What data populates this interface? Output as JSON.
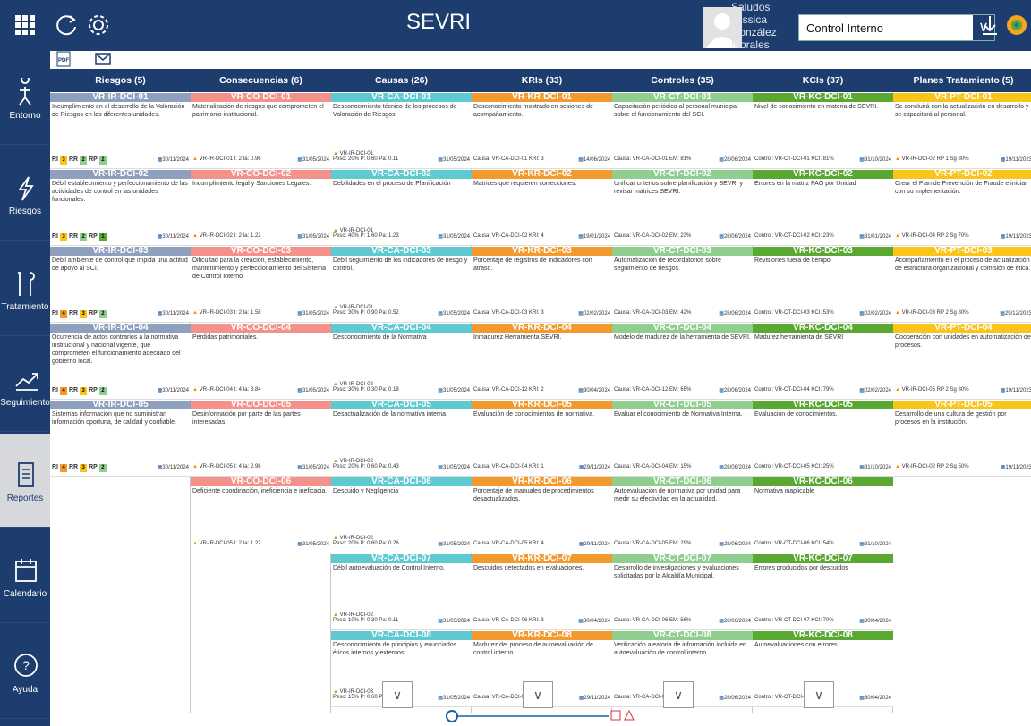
{
  "app": {
    "title": "SEVRI"
  },
  "user": {
    "name": "Saludos Jessica González Morales"
  },
  "entity_select": {
    "value": "Control Interno"
  },
  "colors": {
    "navy": "#1d3d6e",
    "riesgos": "#8fa0bf",
    "consecuencias": "#f4918a",
    "causas": "#5ec9d0",
    "kris": "#f39a2e",
    "controles": "#8fce8f",
    "kcis": "#5aa832",
    "planes": "#f9c51a"
  },
  "sidebar": [
    {
      "label": "Entorno",
      "icon": "person-icon"
    },
    {
      "label": "Riesgos",
      "icon": "lightning-icon"
    },
    {
      "label": "Tratamiento",
      "icon": "tools-icon"
    },
    {
      "label": "Seguimiento",
      "icon": "trend-icon"
    },
    {
      "label": "Reportes",
      "icon": "report-icon"
    },
    {
      "label": "Calendario",
      "icon": "calendar-icon"
    },
    {
      "label": "Ayuda",
      "icon": "help-icon"
    }
  ],
  "columns": [
    {
      "title": "Riesgos (5)",
      "color": "#8fa0bf",
      "cards": [
        {
          "code": "VR-IR-DCI-01",
          "desc": "Incumplimiento en el desarrollo de la Valoración de Riesgos en las diferentes unidades.",
          "foot": "RI 3 RR 2 RP 2",
          "date": "30/11/2024"
        },
        {
          "code": "VR-IR-DCI-02",
          "desc": "Débil establecimiento y perfeccionamiento de las actividades de control en las unidades funcionales.",
          "foot": "RI 3 RR 2 RP 1",
          "date": "30/11/2024"
        },
        {
          "code": "VR-IR-DCI-03",
          "desc": "Débil ambiente de control que impida una actitud de apoyo al SCI.",
          "foot": "RI 4 RR 3 RP 2",
          "date": "30/11/2024"
        },
        {
          "code": "VR-IR-DCI-04",
          "desc": "Ocurrencia de actos contrarios a la normativa institucional y nacional vigente, que comprometen el funcionamiento adecuado del gobierno local.",
          "foot": "RI 4 RR 3 RP 2",
          "date": "30/11/2024"
        },
        {
          "code": "VR-IR-DCI-05",
          "desc": "Sistemas información que no suministran información oportuna, de calidad y confiable.",
          "foot": "RI 4 RR 3 RP 2",
          "date": "30/11/2024"
        }
      ]
    },
    {
      "title": "Consecuencias (6)",
      "color": "#f4918a",
      "cards": [
        {
          "code": "VR-CO-DCI-01",
          "desc": "Materialización de riesgos que comprometen el patrimonio institucional.",
          "foot": "VR-IR-DCI-01  I: 2  Ia: 0.96",
          "date": "31/05/2024"
        },
        {
          "code": "VR-CO-DCI-02",
          "desc": "Incumplimiento legal y Sanciones Legales.",
          "foot": "VR-IR-DCI-02  I: 2  Ia: 1.22",
          "date": "31/05/2024"
        },
        {
          "code": "VR-CO-DCI-03",
          "desc": "Dificultad para la creación, establecimiento, mantenimiento y perfeccionamiento del Sistema de Control Interno.",
          "foot": "VR-IR-DCI-03  I: 2  Ia: 1.58",
          "date": "31/05/2024"
        },
        {
          "code": "VR-CO-DCI-04",
          "desc": "Perdidas patrimoniales.",
          "foot": "VR-IR-DCI-04  I: 4  Ia: 3.84",
          "date": "31/05/2024"
        },
        {
          "code": "VR-CO-DCI-05",
          "desc": "Desinformación por parte de las partes interesadas.",
          "foot": "VR-IR-DCI-05  I: 4  Ia: 2.96",
          "date": "31/05/2024"
        },
        {
          "code": "VR-CO-DCI-06",
          "desc": "Deficiente coordinación, ineficiencia e ineficacia.",
          "foot": "VR-IR-DCI-05  I: 2  Ia: 1.22",
          "date": "31/05/2024"
        }
      ]
    },
    {
      "title": "Causas (26)",
      "color": "#5ec9d0",
      "cards": [
        {
          "code": "VR-CA-DCI-01",
          "desc": "Desconocimiento técnico de los procesos de Valoración de Riesgos.",
          "foot": "Peso: 20%  P: 0.60  Pa: 0.11",
          "date": "31/05/2024",
          "ref": "VR-IR-DCI-01"
        },
        {
          "code": "VR-CA-DCI-02",
          "desc": "Debilidades en el proceso de Planificación",
          "foot": "Peso: 40%  P: 1.60  Pa: 1.23",
          "date": "31/05/2024",
          "ref": "VR-IR-DCI-01"
        },
        {
          "code": "VR-CA-DCI-03",
          "desc": "Débil seguimiento de los indicadores de riesgo y control.",
          "foot": "Peso: 30%  P: 0.90  Pa: 0.52",
          "date": "31/05/2024",
          "ref": "VR-IR-DCI-01"
        },
        {
          "code": "VR-CA-DCI-04",
          "desc": "Desconocimiento de la Normativa",
          "foot": "Peso: 30%  P: 0.30  Pa: 0.18",
          "date": "31/05/2024",
          "ref": "VR-IR-DCI-02"
        },
        {
          "code": "VR-CA-DCI-05",
          "desc": "Desactualización de la normativa interna.",
          "foot": "Peso: 20%  P: 0.60  Pa: 0.43",
          "date": "31/05/2024",
          "ref": "VR-IR-DCI-02"
        },
        {
          "code": "VR-CA-DCI-06",
          "desc": "Descuido y Negligencia",
          "foot": "Peso: 20%  P: 0.60  Pa: 0.26",
          "date": "31/05/2024",
          "ref": "VR-IR-DCI-02"
        },
        {
          "code": "VR-CA-DCI-07",
          "desc": "Débil autoevaluación de Control Interno.",
          "foot": "Peso: 10%  P: 0.30  Pa: 0.11",
          "date": "31/05/2024",
          "ref": "VR-IR-DCI-02"
        },
        {
          "code": "VR-CA-DCI-08",
          "desc": "Desconocimiento de principios y enunciados éticos internos y externos",
          "foot": "Peso: 15%  P: 0.60  P",
          "date": "31/05/2024",
          "ref": "VR-IR-DCI-03"
        }
      ]
    },
    {
      "title": "KRIs (33)",
      "color": "#f39a2e",
      "cards": [
        {
          "code": "VR-KR-DCI-01",
          "desc": "Desconocimiento mostrado en sesiones de acompañamiento.",
          "foot": "Causa: VR-CA-DCI-01  KRI: 3",
          "date": "14/06/2024"
        },
        {
          "code": "VR-KR-DCI-02",
          "desc": "Matrices que requieren correcciones.",
          "foot": "Causa: VR-CA-DCI-02  KRI: 4",
          "date": "19/01/2024"
        },
        {
          "code": "VR-KR-DCI-03",
          "desc": "Porcentaje de registros de indicadores con atraso.",
          "foot": "Causa: VR-CA-DCI-03  KRI: 3",
          "date": "02/02/2024"
        },
        {
          "code": "VR-KR-DCI-04",
          "desc": "Inmadurez Herramienta SEVRI.",
          "foot": "Causa: VR-CA-DCI-12  KRI: 2",
          "date": "30/04/2024"
        },
        {
          "code": "VR-KR-DCI-05",
          "desc": "Evaluación de conocimientos de normativa.",
          "foot": "Causa: VR-CA-DCI-04  KRI: 1",
          "date": "29/11/2024"
        },
        {
          "code": "VR-KR-DCI-06",
          "desc": "Porcentaje de manuales de procedimientos desactualizados.",
          "foot": "Causa: VR-CA-DCI-05  KRI: 4",
          "date": "29/11/2024"
        },
        {
          "code": "VR-KR-DCI-07",
          "desc": "Descuidos detectados en evaluaciones.",
          "foot": "Causa: VR-CA-DCI-06  KRI: 3",
          "date": "30/04/2024"
        },
        {
          "code": "VR-KR-DCI-08",
          "desc": "Madurez del proceso de autoevaluación de control interno.",
          "foot": "Causa: VR-CA-DCI-07  KRI: 2",
          "date": "29/11/2024"
        }
      ]
    },
    {
      "title": "Controles (35)",
      "color": "#8fce8f",
      "cards": [
        {
          "code": "VR-CT-DCI-01",
          "desc": "Capacitación periódica al personal municipal sobre el funcionamiento del SCI.",
          "foot": "Causa: VR-CA-DCI-01  EM: 81%",
          "date": "28/06/2024"
        },
        {
          "code": "VR-CT-DCI-02",
          "desc": "Unificar criterios sobre planificación y SEVRI y revisar matrices SEVRI.",
          "foot": "Causa: VR-CA-DCI-02  EM: 23%",
          "date": "28/06/2024"
        },
        {
          "code": "VR-CT-DCI-03",
          "desc": "Automatización de recordatorios sobre seguimiento de riesgos.",
          "foot": "Causa: VR-CA-DCI-03  EM: 42%",
          "date": "28/06/2024"
        },
        {
          "code": "VR-CT-DCI-04",
          "desc": "Modelo de madurez de la herramienta de SEVRI.",
          "foot": "Causa: VR-CA-DCI-12  EM: 65%",
          "date": "28/06/2024"
        },
        {
          "code": "VR-CT-DCI-05",
          "desc": "Evaluar el conocimiento de Normativa Interna.",
          "foot": "Causa: VR-CA-DCI-04  EM: 15%",
          "date": "28/06/2024"
        },
        {
          "code": "VR-CT-DCI-06",
          "desc": "Autoevaluación de normativa por unidad para medir su efectividad en la actualidad.",
          "foot": "Causa: VR-CA-DCI-05  EM: 29%",
          "date": "28/06/2024"
        },
        {
          "code": "VR-CT-DCI-07",
          "desc": "Desarrollo de investigaciones y evaluaciones solicitadas por la Alcaldía Municipal.",
          "foot": "Causa: VR-CA-DCI-06  EM: 56%",
          "date": "28/06/2024"
        },
        {
          "code": "VR-CT-DCI-08",
          "desc": "Verificación aleatoria de información incluida en autoevaluación de control interno.",
          "foot": "Causa: VR-CA-DCI-07  EM: 65%",
          "date": "28/06/2024"
        }
      ]
    },
    {
      "title": "KCIs (37)",
      "color": "#5aa832",
      "cards": [
        {
          "code": "VR-KC-DCI-01",
          "desc": "Nivel de conocimiento en materia de SEVRI.",
          "foot": "Control: VR-CT-DCI-01  KCI: 81%",
          "date": "31/10/2024"
        },
        {
          "code": "VR-KC-DCI-02",
          "desc": "Errores en la matriz PAO por Unidad",
          "foot": "Control: VR-CT-DCI-02  KCI: 23%",
          "date": "31/01/2024"
        },
        {
          "code": "VR-KC-DCI-03",
          "desc": "Revisiones fuera de tiempo",
          "foot": "Control: VR-CT-DCI-03  KCI: 53%",
          "date": "02/02/2024"
        },
        {
          "code": "VR-KC-DCI-04",
          "desc": "Madurez herramienta de SEVRI",
          "foot": "Control: VR-CT-DCI-04  KCI: 79%",
          "date": "02/02/2024"
        },
        {
          "code": "VR-KC-DCI-05",
          "desc": "Evaluación de conocimientos.",
          "foot": "Control: VR-CT-DCI-05  KCI: 25%",
          "date": "31/10/2024"
        },
        {
          "code": "VR-KC-DCI-06",
          "desc": "Normativa inaplicable",
          "foot": "Control: VR-CT-DCI-06  KCI: 54%",
          "date": "31/10/2024"
        },
        {
          "code": "VR-KC-DCI-07",
          "desc": "Errores producidos por descuidos",
          "foot": "Control: VR-CT-DCI-07  KCI: 70%",
          "date": "30/04/2024"
        },
        {
          "code": "VR-KC-DCI-08",
          "desc": "Autoevaluaciones con errores",
          "foot": "Control: VR-CT-DCI-08  KCI: 65%",
          "date": "30/04/2024"
        }
      ]
    },
    {
      "title": "Planes Tratamiento (5)",
      "color": "#f9c51a",
      "cards": [
        {
          "code": "VR-PT-DCI-01",
          "desc": "Se concluirá con la actualización en desarrollo y se capacitará al personal.",
          "foot": "VR-IR-DCI-02  RP 1  Sg 80%",
          "date": "19/11/2023"
        },
        {
          "code": "VR-PT-DCI-02",
          "desc": "Crear el Plan de Prevención de Fraude e iniciar con su implementación.",
          "foot": "VR-IR-DCI-04  RP 2  Sg 70%",
          "date": "19/11/2023"
        },
        {
          "code": "VR-PT-DCI-03",
          "desc": "Acompañamiento en el proceso de actualización de estructura organizacional y comisión de ética.",
          "foot": "VR-IR-DCI-03  RP 2  Sg 80%",
          "date": "29/12/2023"
        },
        {
          "code": "VR-PT-DCI-04",
          "desc": "Cooperación con unidades en automatización de procesos.",
          "foot": "VR-IR-DCI-05  RP 2  Sg 80%",
          "date": "19/11/2023"
        },
        {
          "code": "VR-PT-DCI-05",
          "desc": "Desarrollo de una cultura de gestión por procesos en la institución.",
          "foot": "VR-IR-DCI-02  RP 2  Sg 50%",
          "date": "19/11/2023"
        }
      ]
    }
  ]
}
